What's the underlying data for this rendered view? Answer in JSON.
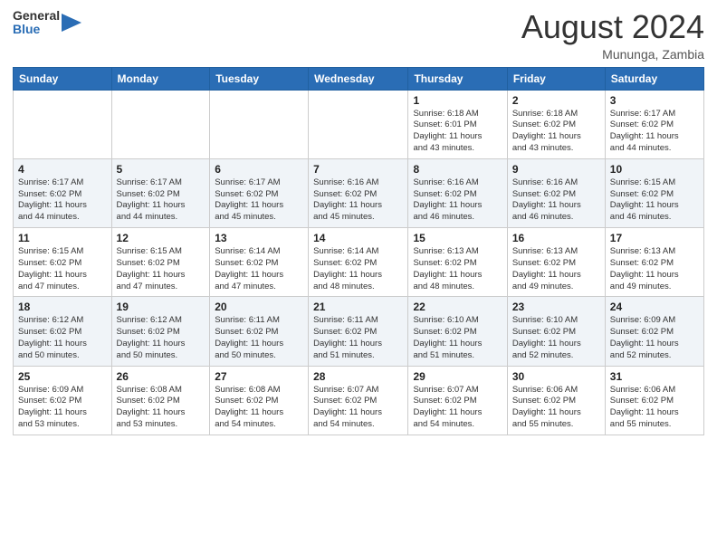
{
  "header": {
    "logo_general": "General",
    "logo_blue": "Blue",
    "title": "August 2024",
    "location": "Mununga, Zambia"
  },
  "weekdays": [
    "Sunday",
    "Monday",
    "Tuesday",
    "Wednesday",
    "Thursday",
    "Friday",
    "Saturday"
  ],
  "weeks": [
    [
      {
        "day": "",
        "info": ""
      },
      {
        "day": "",
        "info": ""
      },
      {
        "day": "",
        "info": ""
      },
      {
        "day": "",
        "info": ""
      },
      {
        "day": "1",
        "info": "Sunrise: 6:18 AM\nSunset: 6:01 PM\nDaylight: 11 hours\nand 43 minutes."
      },
      {
        "day": "2",
        "info": "Sunrise: 6:18 AM\nSunset: 6:02 PM\nDaylight: 11 hours\nand 43 minutes."
      },
      {
        "day": "3",
        "info": "Sunrise: 6:17 AM\nSunset: 6:02 PM\nDaylight: 11 hours\nand 44 minutes."
      }
    ],
    [
      {
        "day": "4",
        "info": "Sunrise: 6:17 AM\nSunset: 6:02 PM\nDaylight: 11 hours\nand 44 minutes."
      },
      {
        "day": "5",
        "info": "Sunrise: 6:17 AM\nSunset: 6:02 PM\nDaylight: 11 hours\nand 44 minutes."
      },
      {
        "day": "6",
        "info": "Sunrise: 6:17 AM\nSunset: 6:02 PM\nDaylight: 11 hours\nand 45 minutes."
      },
      {
        "day": "7",
        "info": "Sunrise: 6:16 AM\nSunset: 6:02 PM\nDaylight: 11 hours\nand 45 minutes."
      },
      {
        "day": "8",
        "info": "Sunrise: 6:16 AM\nSunset: 6:02 PM\nDaylight: 11 hours\nand 46 minutes."
      },
      {
        "day": "9",
        "info": "Sunrise: 6:16 AM\nSunset: 6:02 PM\nDaylight: 11 hours\nand 46 minutes."
      },
      {
        "day": "10",
        "info": "Sunrise: 6:15 AM\nSunset: 6:02 PM\nDaylight: 11 hours\nand 46 minutes."
      }
    ],
    [
      {
        "day": "11",
        "info": "Sunrise: 6:15 AM\nSunset: 6:02 PM\nDaylight: 11 hours\nand 47 minutes."
      },
      {
        "day": "12",
        "info": "Sunrise: 6:15 AM\nSunset: 6:02 PM\nDaylight: 11 hours\nand 47 minutes."
      },
      {
        "day": "13",
        "info": "Sunrise: 6:14 AM\nSunset: 6:02 PM\nDaylight: 11 hours\nand 47 minutes."
      },
      {
        "day": "14",
        "info": "Sunrise: 6:14 AM\nSunset: 6:02 PM\nDaylight: 11 hours\nand 48 minutes."
      },
      {
        "day": "15",
        "info": "Sunrise: 6:13 AM\nSunset: 6:02 PM\nDaylight: 11 hours\nand 48 minutes."
      },
      {
        "day": "16",
        "info": "Sunrise: 6:13 AM\nSunset: 6:02 PM\nDaylight: 11 hours\nand 49 minutes."
      },
      {
        "day": "17",
        "info": "Sunrise: 6:13 AM\nSunset: 6:02 PM\nDaylight: 11 hours\nand 49 minutes."
      }
    ],
    [
      {
        "day": "18",
        "info": "Sunrise: 6:12 AM\nSunset: 6:02 PM\nDaylight: 11 hours\nand 50 minutes."
      },
      {
        "day": "19",
        "info": "Sunrise: 6:12 AM\nSunset: 6:02 PM\nDaylight: 11 hours\nand 50 minutes."
      },
      {
        "day": "20",
        "info": "Sunrise: 6:11 AM\nSunset: 6:02 PM\nDaylight: 11 hours\nand 50 minutes."
      },
      {
        "day": "21",
        "info": "Sunrise: 6:11 AM\nSunset: 6:02 PM\nDaylight: 11 hours\nand 51 minutes."
      },
      {
        "day": "22",
        "info": "Sunrise: 6:10 AM\nSunset: 6:02 PM\nDaylight: 11 hours\nand 51 minutes."
      },
      {
        "day": "23",
        "info": "Sunrise: 6:10 AM\nSunset: 6:02 PM\nDaylight: 11 hours\nand 52 minutes."
      },
      {
        "day": "24",
        "info": "Sunrise: 6:09 AM\nSunset: 6:02 PM\nDaylight: 11 hours\nand 52 minutes."
      }
    ],
    [
      {
        "day": "25",
        "info": "Sunrise: 6:09 AM\nSunset: 6:02 PM\nDaylight: 11 hours\nand 53 minutes."
      },
      {
        "day": "26",
        "info": "Sunrise: 6:08 AM\nSunset: 6:02 PM\nDaylight: 11 hours\nand 53 minutes."
      },
      {
        "day": "27",
        "info": "Sunrise: 6:08 AM\nSunset: 6:02 PM\nDaylight: 11 hours\nand 54 minutes."
      },
      {
        "day": "28",
        "info": "Sunrise: 6:07 AM\nSunset: 6:02 PM\nDaylight: 11 hours\nand 54 minutes."
      },
      {
        "day": "29",
        "info": "Sunrise: 6:07 AM\nSunset: 6:02 PM\nDaylight: 11 hours\nand 54 minutes."
      },
      {
        "day": "30",
        "info": "Sunrise: 6:06 AM\nSunset: 6:02 PM\nDaylight: 11 hours\nand 55 minutes."
      },
      {
        "day": "31",
        "info": "Sunrise: 6:06 AM\nSunset: 6:02 PM\nDaylight: 11 hours\nand 55 minutes."
      }
    ]
  ]
}
